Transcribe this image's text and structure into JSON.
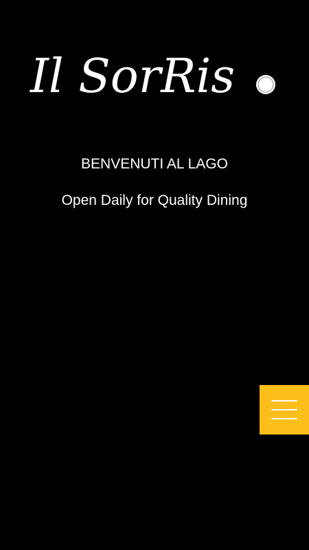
{
  "header": {
    "logo_text": "Il SorRis",
    "logo_trailing_letter": "o"
  },
  "hero": {
    "welcome": "BENVENUTI AL LAGO",
    "tagline": "Open Daily for Quality Dining"
  },
  "menu_button": {
    "icon": "hamburger-menu-icon",
    "color": "#FCBE1A"
  },
  "theme": {
    "background": "#000000",
    "text": "#FFFFFF",
    "accent": "#FCBE1A"
  }
}
